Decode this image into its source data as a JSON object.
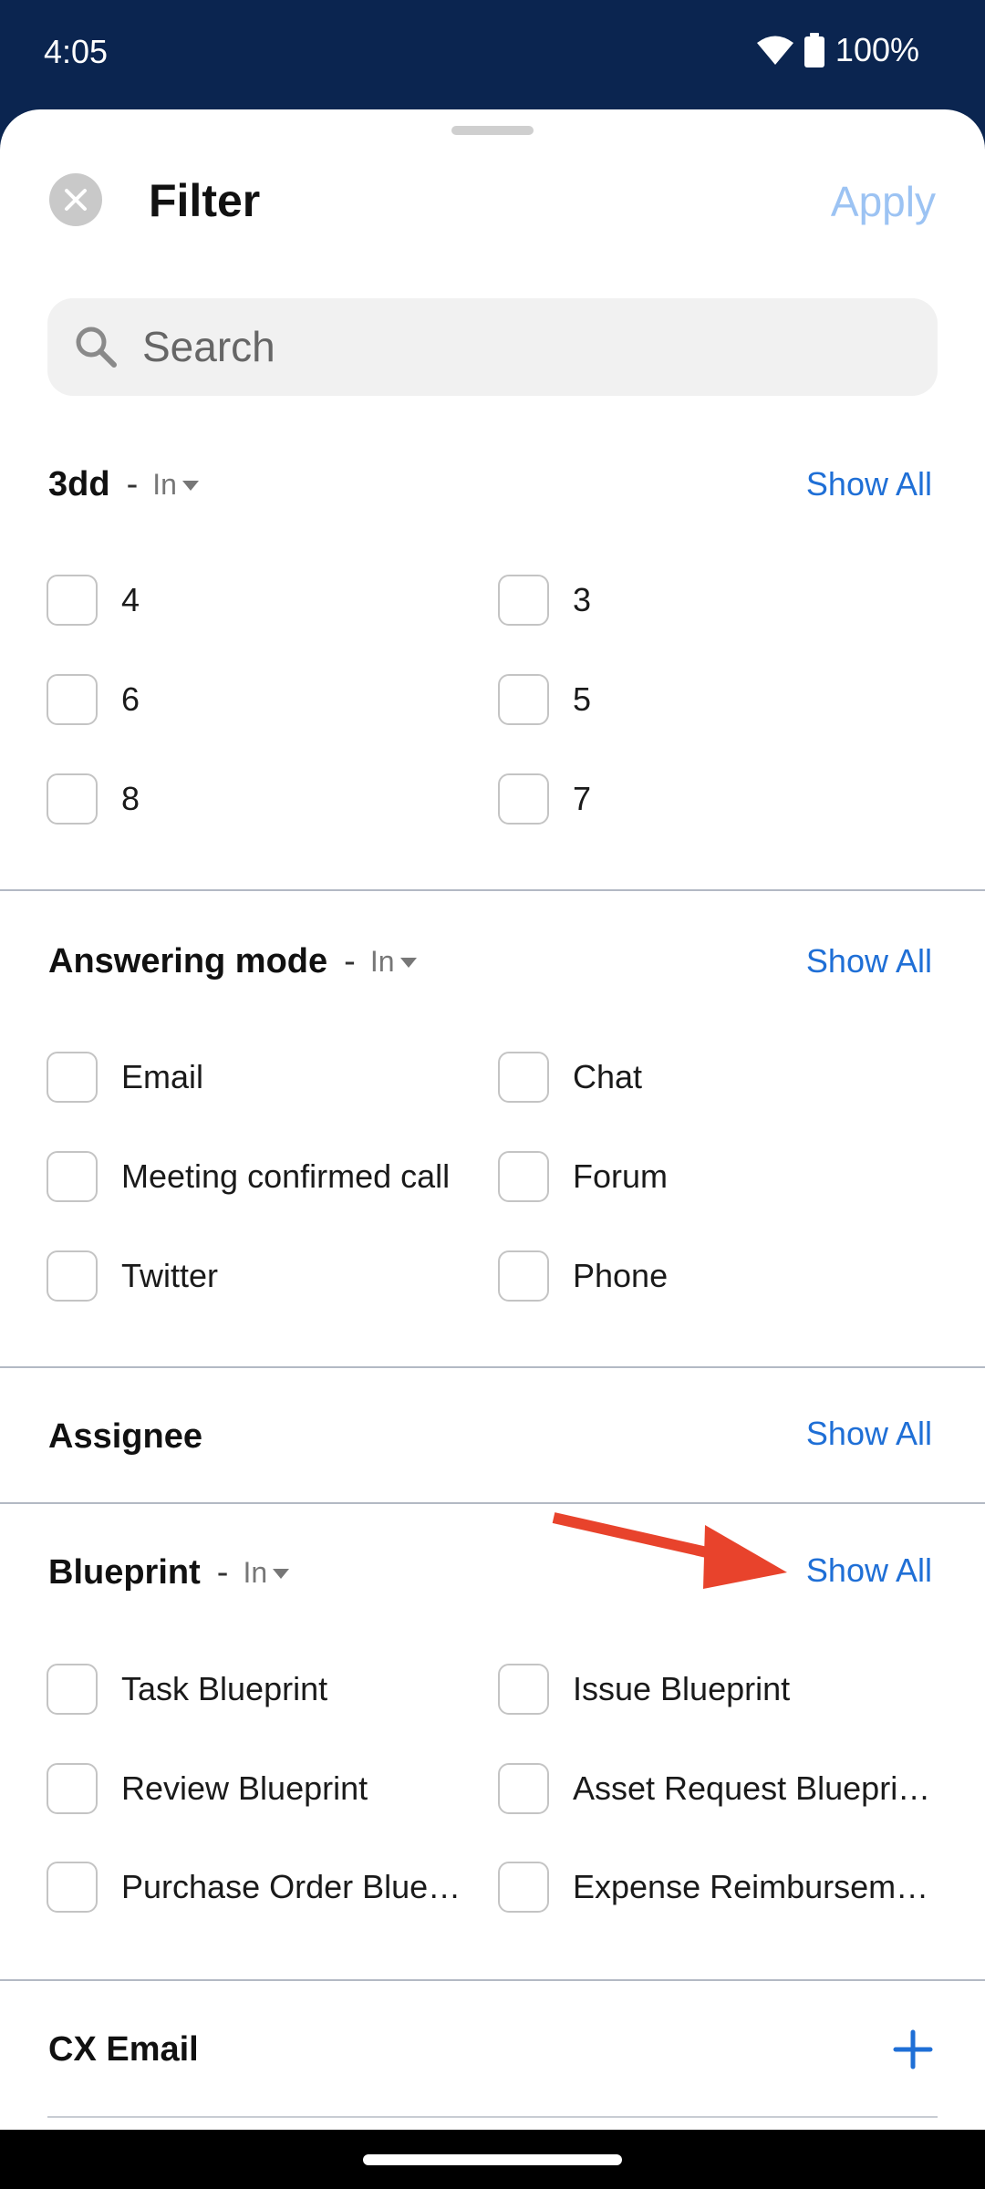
{
  "status_bar": {
    "time": "4:05",
    "battery": "100%"
  },
  "header": {
    "title": "Filter",
    "apply_label": "Apply"
  },
  "search": {
    "placeholder": "Search"
  },
  "sections": [
    {
      "title": "3dd",
      "operator": "In",
      "show_all_label": "Show All",
      "options": [
        "4",
        "3",
        "6",
        "5",
        "8",
        "7"
      ]
    },
    {
      "title": "Answering mode",
      "operator": "In",
      "show_all_label": "Show All",
      "options": [
        "Email",
        "Chat",
        "Meeting confirmed call",
        "Forum",
        "Twitter",
        "Phone"
      ]
    },
    {
      "title": "Assignee",
      "show_all_label": "Show All"
    },
    {
      "title": "Blueprint",
      "operator": "In",
      "show_all_label": "Show All",
      "options": [
        "Task Blueprint",
        "Issue Blueprint",
        "Review Blueprint",
        "Asset Request Bluepri…",
        "Purchase Order Bluep…",
        "Expense Reimbursem…"
      ]
    },
    {
      "title": "CX Email"
    }
  ],
  "colors": {
    "accent": "#1f6fd6",
    "apply_disabled": "#9cc3f3",
    "status_bar_bg": "#0b2550",
    "annotation_arrow": "#e8432c"
  }
}
